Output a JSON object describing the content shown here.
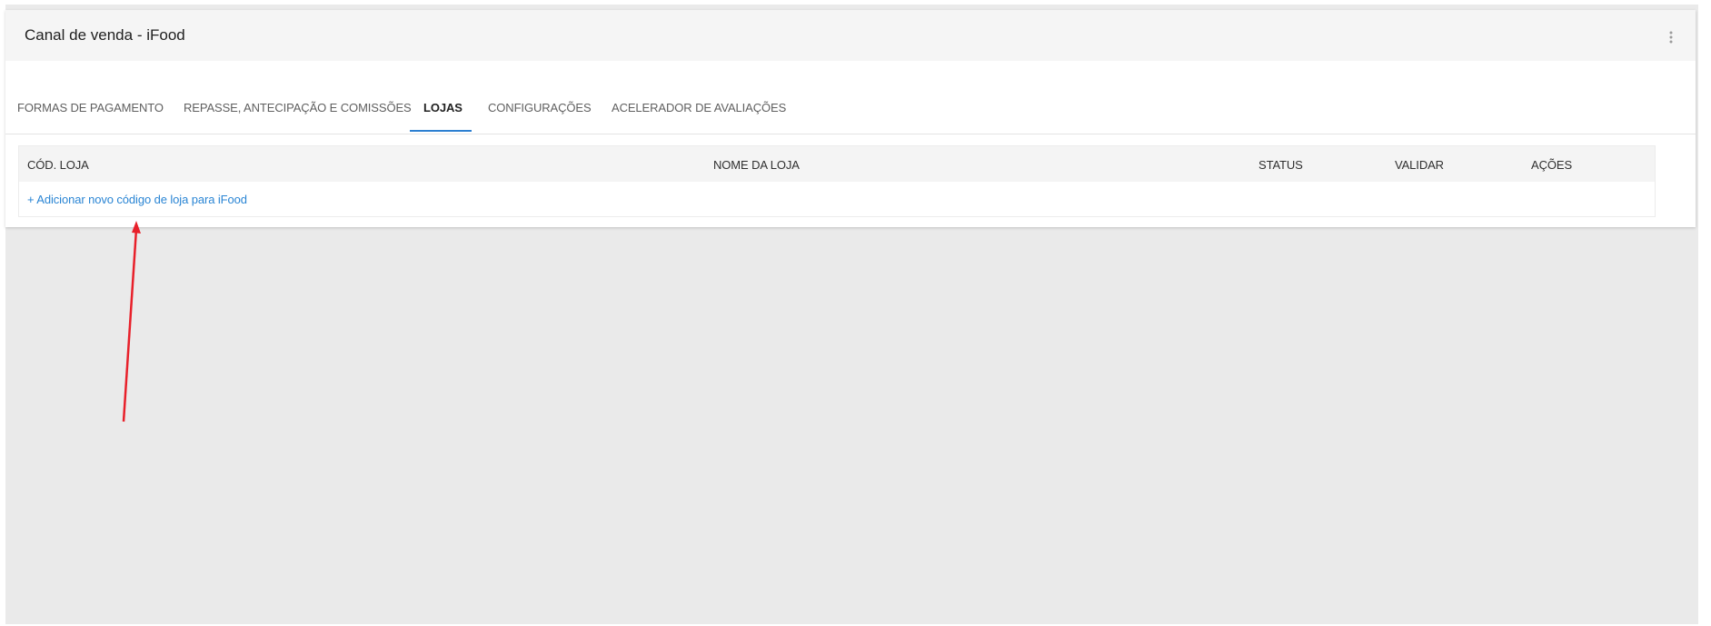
{
  "card": {
    "title": "Canal de venda - iFood"
  },
  "tabs": [
    {
      "label": "FORMAS DE PAGAMENTO",
      "active": false
    },
    {
      "label": "REPASSE, ANTECIPAÇÃO E COMISSÕES",
      "active": false
    },
    {
      "label": "LOJAS",
      "active": true
    },
    {
      "label": "CONFIGURAÇÕES",
      "active": false
    },
    {
      "label": "ACELERADOR DE AVALIAÇÕES",
      "active": false
    }
  ],
  "table": {
    "columns": [
      "CÓD. LOJA",
      "NOME DA LOJA",
      "STATUS",
      "VALIDAR",
      "AÇÕES"
    ],
    "add_link": "+ Adicionar novo código de loja para iFood"
  },
  "icons": {
    "menu": "more-vert-icon",
    "annotation": "red-arrow-icon"
  },
  "colors": {
    "accent": "#2c7fd1",
    "link": "#2a85d4",
    "annotation": "#e8202a",
    "background": "#eaeaea"
  }
}
